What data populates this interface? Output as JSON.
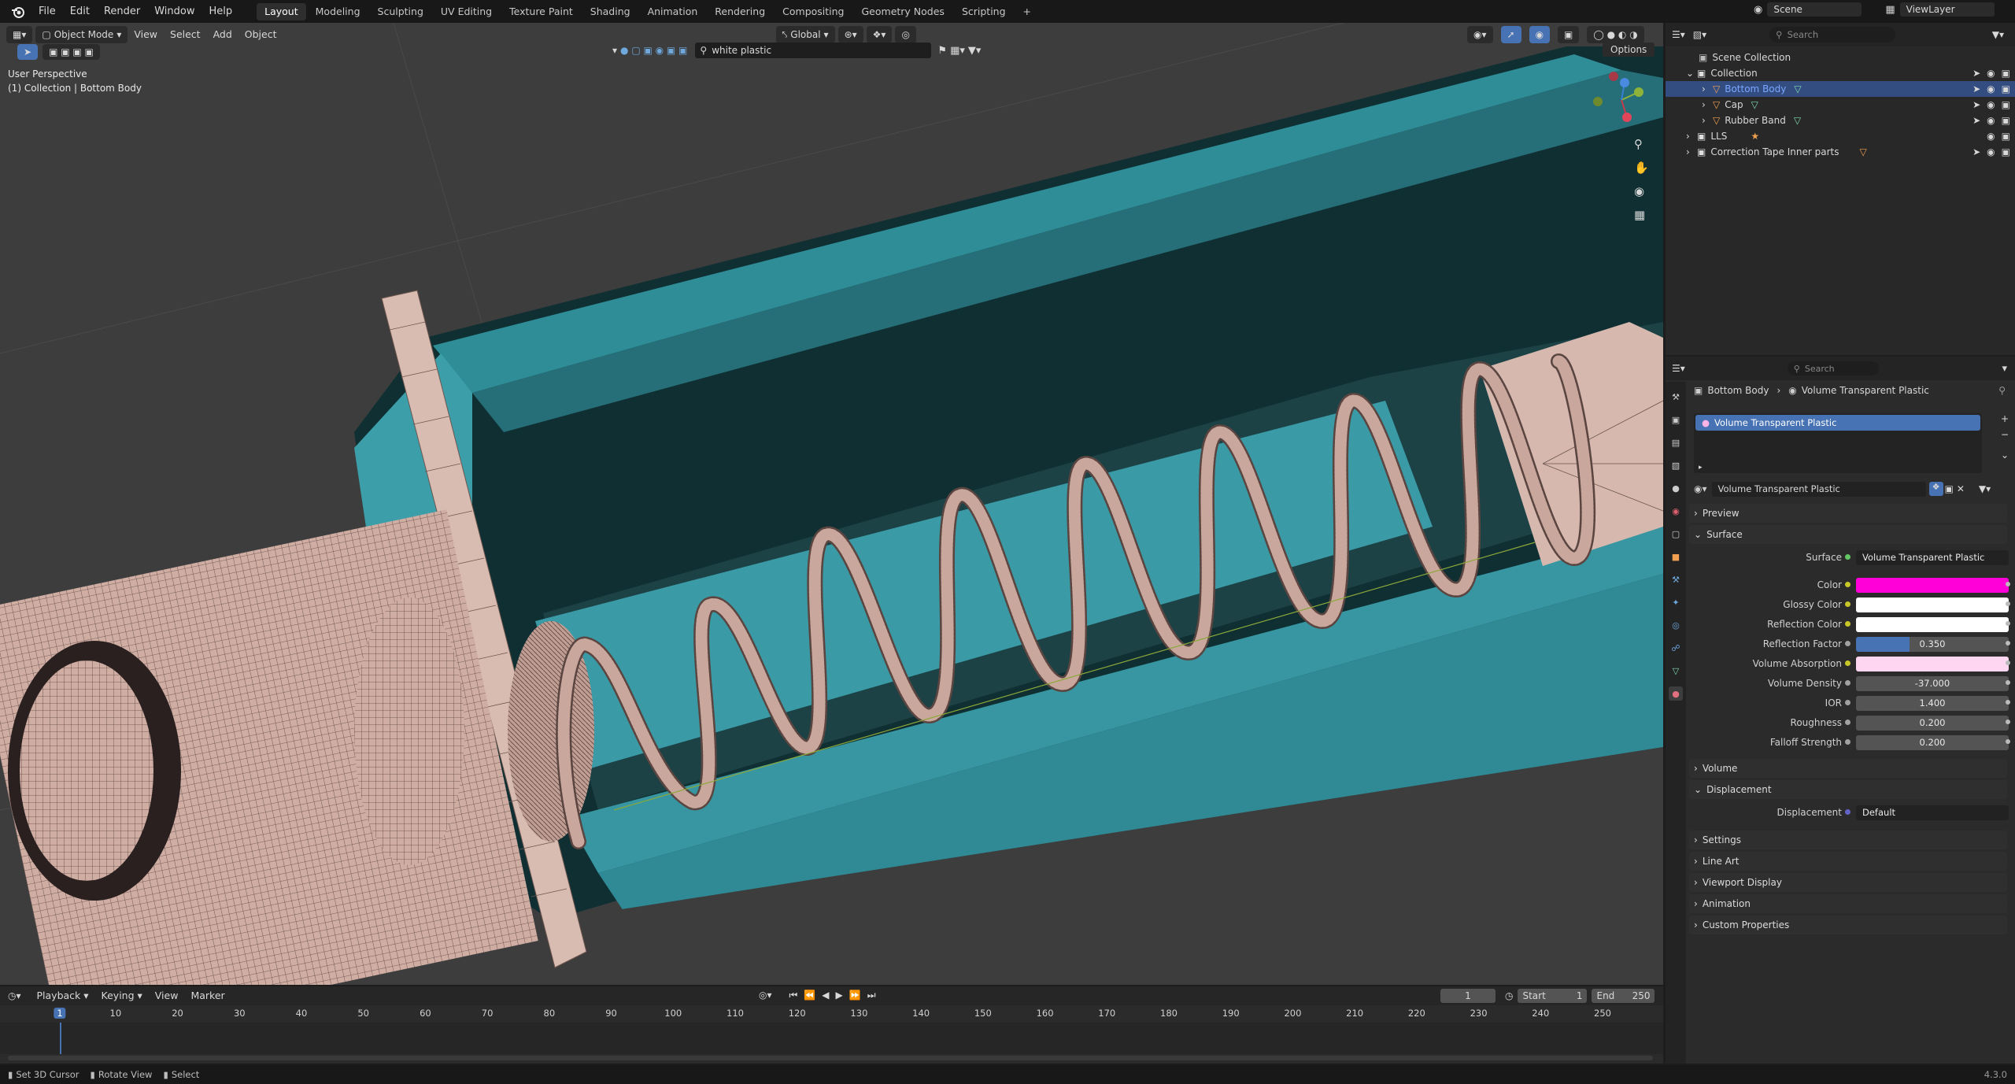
{
  "menubar": {
    "menus": [
      "File",
      "Edit",
      "Render",
      "Window",
      "Help"
    ],
    "workspaces": [
      "Layout",
      "Modeling",
      "Sculpting",
      "UV Editing",
      "Texture Paint",
      "Shading",
      "Animation",
      "Rendering",
      "Compositing",
      "Geometry Nodes",
      "Scripting"
    ],
    "active_workspace": "Layout",
    "add_tab": "+",
    "scene_label": "Scene",
    "viewlayer_label": "ViewLayer"
  },
  "viewport": {
    "mode": "Object Mode",
    "menus": [
      "View",
      "Select",
      "Add",
      "Object"
    ],
    "transform_orientation": "Global",
    "search_value": "white plastic",
    "options_label": "Options",
    "perspective_label": "User Perspective",
    "collection_label": "(1) Collection | Bottom Body"
  },
  "outliner": {
    "search_placeholder": "Search",
    "root": "Scene Collection",
    "items": [
      {
        "label": "Collection",
        "indent": 1
      },
      {
        "label": "Bottom Body",
        "indent": 2,
        "selected": true
      },
      {
        "label": "Cap",
        "indent": 2
      },
      {
        "label": "Rubber Band",
        "indent": 2
      },
      {
        "label": "LLS",
        "indent": 1
      },
      {
        "label": "Correction Tape Inner parts",
        "indent": 1
      }
    ]
  },
  "properties": {
    "search_placeholder": "Search",
    "breadcrumb_object": "Bottom Body",
    "breadcrumb_material": "Volume Transparent Plastic",
    "slot_name": "Volume Transparent Plastic",
    "material_name": "Volume Transparent Plastic",
    "panels": {
      "preview": "Preview",
      "surface": "Surface",
      "volume": "Volume",
      "displacement": "Displacement",
      "settings": "Settings",
      "line_art": "Line Art",
      "viewport_display": "Viewport Display",
      "animation": "Animation",
      "custom_properties": "Custom Properties"
    },
    "surface_label": "Surface",
    "surface_value": "Volume Transparent Plastic",
    "rows": [
      {
        "label": "Color",
        "value": "",
        "color": "#ff00d9"
      },
      {
        "label": "Glossy Color",
        "value": "",
        "color": "#ffffff"
      },
      {
        "label": "Reflection Color",
        "value": "",
        "color": "#ffffff"
      },
      {
        "label": "Reflection Factor",
        "value": "0.350",
        "fill": 0.35
      },
      {
        "label": "Volume Absorption",
        "value": "",
        "color": "#ffd6f2"
      },
      {
        "label": "Volume Density",
        "value": "-37.000"
      },
      {
        "label": "IOR",
        "value": "1.400"
      },
      {
        "label": "Roughness",
        "value": "0.200"
      },
      {
        "label": "Falloff Strength",
        "value": "0.200"
      }
    ],
    "displacement_label": "Displacement",
    "displacement_value": "Default"
  },
  "timeline": {
    "menus": [
      "Playback",
      "Keying",
      "View",
      "Marker"
    ],
    "current_frame": "1",
    "start_label": "Start",
    "start_value": "1",
    "end_label": "End",
    "end_value": "250",
    "ruler_ticks": [
      1,
      10,
      20,
      30,
      40,
      50,
      60,
      70,
      80,
      90,
      100,
      110,
      120,
      130,
      140,
      150,
      160,
      170,
      180,
      190,
      200,
      210,
      220,
      230,
      240,
      250
    ]
  },
  "statusbar": {
    "hints": [
      "Set 3D Cursor",
      "Rotate View",
      "Select"
    ],
    "version": "4.3.0"
  },
  "colors": {
    "teal": "#3a9aa6",
    "accent_blue": "#4772b3",
    "selected_row": "#334d80"
  }
}
